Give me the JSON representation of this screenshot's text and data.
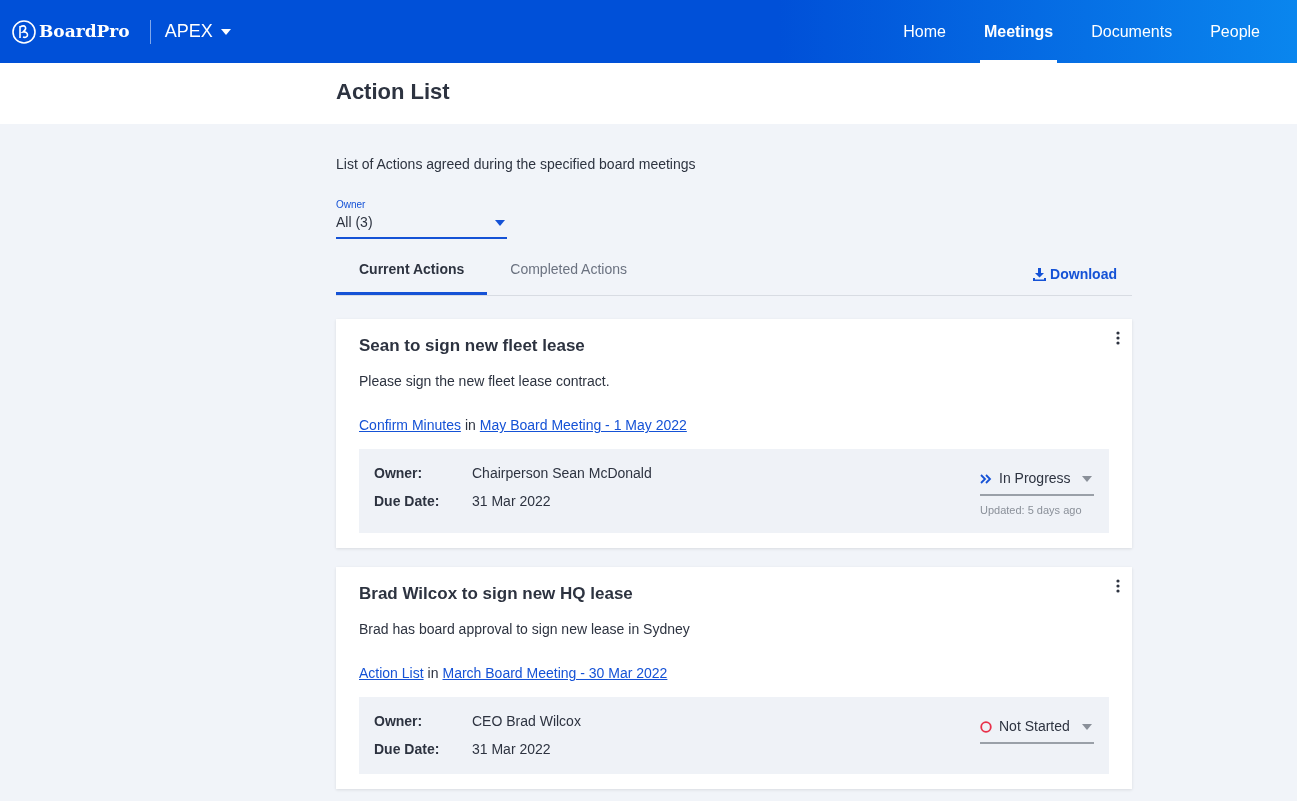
{
  "navbar": {
    "brand": "BoardPro",
    "org": "APEX",
    "links": [
      {
        "label": "Home",
        "selected": false
      },
      {
        "label": "Meetings",
        "selected": true
      },
      {
        "label": "Documents",
        "selected": false
      },
      {
        "label": "People",
        "selected": false
      }
    ]
  },
  "page": {
    "title": "Action List",
    "description": "List of Actions agreed during the specified board meetings"
  },
  "owner_filter": {
    "label": "Owner",
    "value": "All (3)"
  },
  "tabs": [
    {
      "label": "Current Actions",
      "selected": true
    },
    {
      "label": "Completed Actions",
      "selected": false
    }
  ],
  "download": "Download",
  "actions": [
    {
      "title": "Sean to sign new fleet lease",
      "description": "Please sign the new fleet lease contract.",
      "item_link": "Confirm Minutes",
      "in": "in",
      "meeting_link": "May Board Meeting - 1 May 2022",
      "owner_label": "Owner:",
      "owner": "Chairperson Sean McDonald",
      "due_label": "Due Date:",
      "due": "31 Mar 2022",
      "status": {
        "kind": "in_progress",
        "label": "In Progress"
      },
      "updated": "Updated: 5 days ago"
    },
    {
      "title": "Brad Wilcox to sign new HQ lease",
      "description": "Brad has board approval to sign new lease in Sydney",
      "item_link": "Action List",
      "in": "in",
      "meeting_link": "March Board Meeting - 30 Mar 2022",
      "owner_label": "Owner:",
      "owner": "CEO Brad Wilcox",
      "due_label": "Due Date:",
      "due": "31 Mar 2022",
      "status": {
        "kind": "not_started",
        "label": "Not Started"
      }
    }
  ]
}
